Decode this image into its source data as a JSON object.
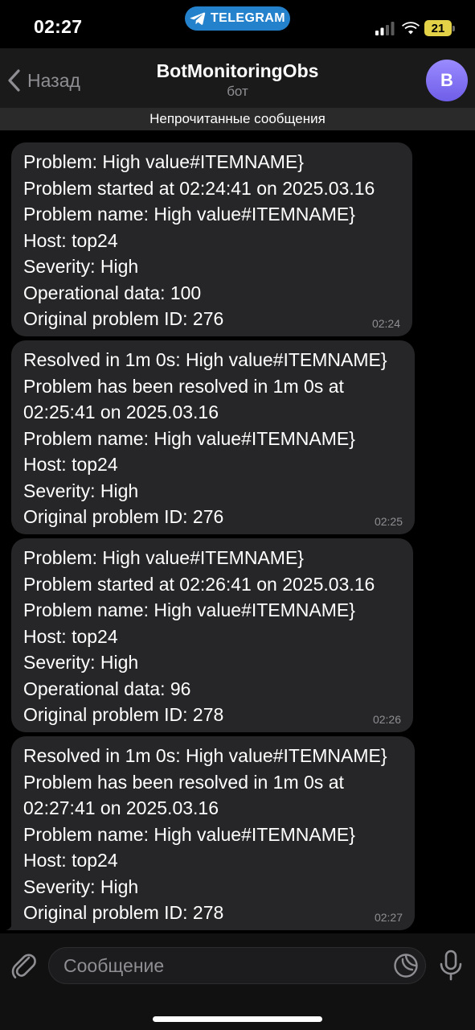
{
  "status_bar": {
    "time": "02:27",
    "pill_label": "TELEGRAM",
    "battery_level": "21",
    "battery_color": "#e3d247",
    "pill_color": "#2481cc"
  },
  "header": {
    "back_label": "Назад",
    "title": "BotMonitoringObs",
    "subtitle": "бот",
    "avatar_letter": "B"
  },
  "unread_banner": "Непрочитанные сообщения",
  "messages": [
    {
      "lines": [
        "Problem: High value#ITEMNAME}",
        "Problem started at 02:24:41 on 2025.03.16",
        "Problem name: High value#ITEMNAME}",
        "Host: top24",
        "Severity: High",
        "Operational data: 100",
        "Original problem ID: 276"
      ],
      "time": "02:24"
    },
    {
      "lines": [
        "Resolved in 1m 0s: High value#ITEMNAME}",
        "Problem has been resolved in 1m 0s at",
        "02:25:41 on 2025.03.16",
        "Problem name: High value#ITEMNAME}",
        "Host: top24",
        "Severity: High",
        "Original problem ID: 276"
      ],
      "time": "02:25"
    },
    {
      "lines": [
        "Problem: High value#ITEMNAME}",
        "Problem started at 02:26:41 on 2025.03.16",
        "Problem name: High value#ITEMNAME}",
        "Host: top24",
        "Severity: High",
        "Operational data: 96",
        "Original problem ID: 278"
      ],
      "time": "02:26"
    },
    {
      "lines": [
        "Resolved in 1m 0s: High value#ITEMNAME}",
        "Problem has been resolved in 1m 0s at",
        "02:27:41 on 2025.03.16",
        "Problem name: High value#ITEMNAME}",
        "Host: top24",
        "Severity: High",
        "Original problem ID: 278"
      ],
      "time": "02:27"
    }
  ],
  "input": {
    "placeholder": "Сообщение"
  }
}
